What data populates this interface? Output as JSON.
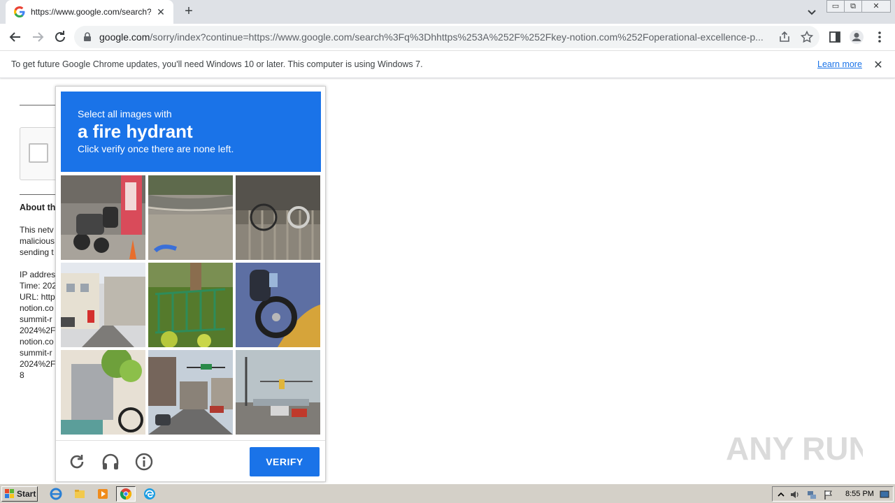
{
  "browser": {
    "tab_title": "https://www.google.com/search?q=",
    "tab_close": "✕",
    "new_tab": "+",
    "url_host": "google.com",
    "url_path": "/sorry/index?continue=https://www.google.com/search%3Fq%3Dhhttps%253A%252F%252Fkey-notion.com%252Foperational-excellence-p...",
    "window_controls": [
      "▭",
      "⧉",
      "✕"
    ]
  },
  "infobar": {
    "message": "To get future Google Chrome updates, you'll need Windows 10 or later. This computer is using Windows 7.",
    "learn_more": "Learn more",
    "close": "✕"
  },
  "background_page": {
    "heading": "About th",
    "lines": [
      "This netv",
      "malicious",
      "sending t",
      "",
      "IP addres",
      "Time: 202",
      "URL: http",
      "notion.co",
      "summit-r",
      "2024%2F",
      "notion.co",
      "summit-r",
      "2024%2F",
      "8"
    ]
  },
  "captcha": {
    "instruction_line1": "Select all images with",
    "target": "a fire hydrant",
    "instruction_line3": "Click verify once there are none left.",
    "verify_label": "VERIFY",
    "header_color": "#1a73e8",
    "tiles": [
      {
        "icon": "scooters-street-tile"
      },
      {
        "icon": "curb-road-tile"
      },
      {
        "icon": "bicycle-fence-tile"
      },
      {
        "icon": "street-buildings-tile"
      },
      {
        "icon": "green-fence-tile"
      },
      {
        "icon": "motorcycle-wheel-tile"
      },
      {
        "icon": "bicycle-wall-tile"
      },
      {
        "icon": "intersection-tile"
      },
      {
        "icon": "traffic-light-road-tile"
      }
    ]
  },
  "watermark": "ANY RUN",
  "taskbar": {
    "start_label": "Start",
    "clock": "8:55 PM"
  }
}
